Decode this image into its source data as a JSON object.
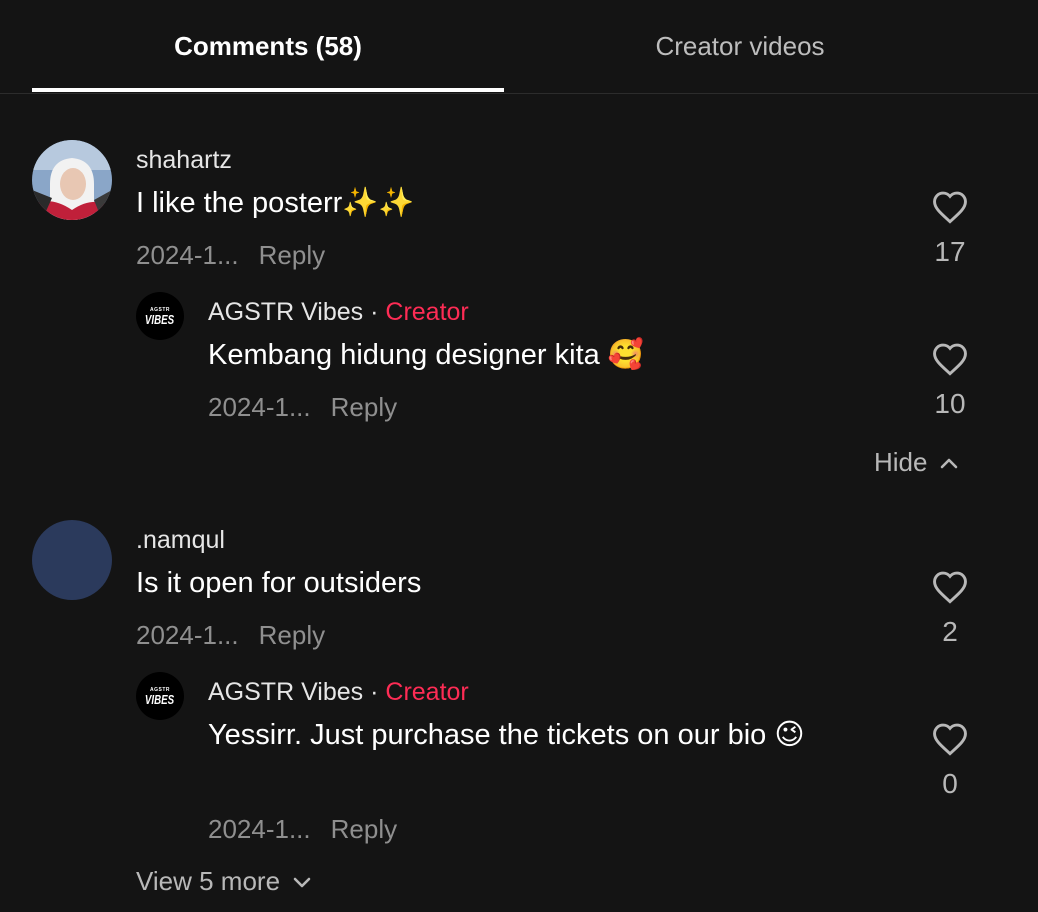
{
  "tabs": [
    {
      "label": "Comments (58)",
      "active": true
    },
    {
      "label": "Creator videos",
      "active": false
    }
  ],
  "comments": [
    {
      "username": "shahartz",
      "text": "I like the posterr✨✨",
      "date": "2024-1...",
      "reply_label": "Reply",
      "likes": "17",
      "avatar": "photo-avatar",
      "replies": [
        {
          "username": "AGSTR Vibes",
          "separator": "·",
          "badge": "Creator",
          "text": "Kembang hidung designer kita 🥰",
          "date": "2024-1...",
          "reply_label": "Reply",
          "likes": "10",
          "avatar_text_small": "AGSTR",
          "avatar_text_big": "VIBES"
        }
      ],
      "toggle_label": "Hide",
      "toggle_icon": "chevron-up-icon"
    },
    {
      "username": ".namqul",
      "text": "Is it open for outsiders",
      "date": "2024-1...",
      "reply_label": "Reply",
      "likes": "2",
      "avatar_color": "#2b3a5c",
      "replies": [
        {
          "username": "AGSTR Vibes",
          "separator": "·",
          "badge": "Creator",
          "text": "Yessirr. Just purchase the tickets on our bio 😉",
          "date": "2024-1...",
          "reply_label": "Reply",
          "likes": "0",
          "avatar_text_small": "AGSTR",
          "avatar_text_big": "VIBES"
        }
      ],
      "toggle_label": "View 5 more",
      "toggle_icon": "chevron-down-icon"
    }
  ],
  "colors": {
    "background": "#141414",
    "creator_badge": "#fe2c55",
    "muted_text": "#8f8f8f"
  }
}
